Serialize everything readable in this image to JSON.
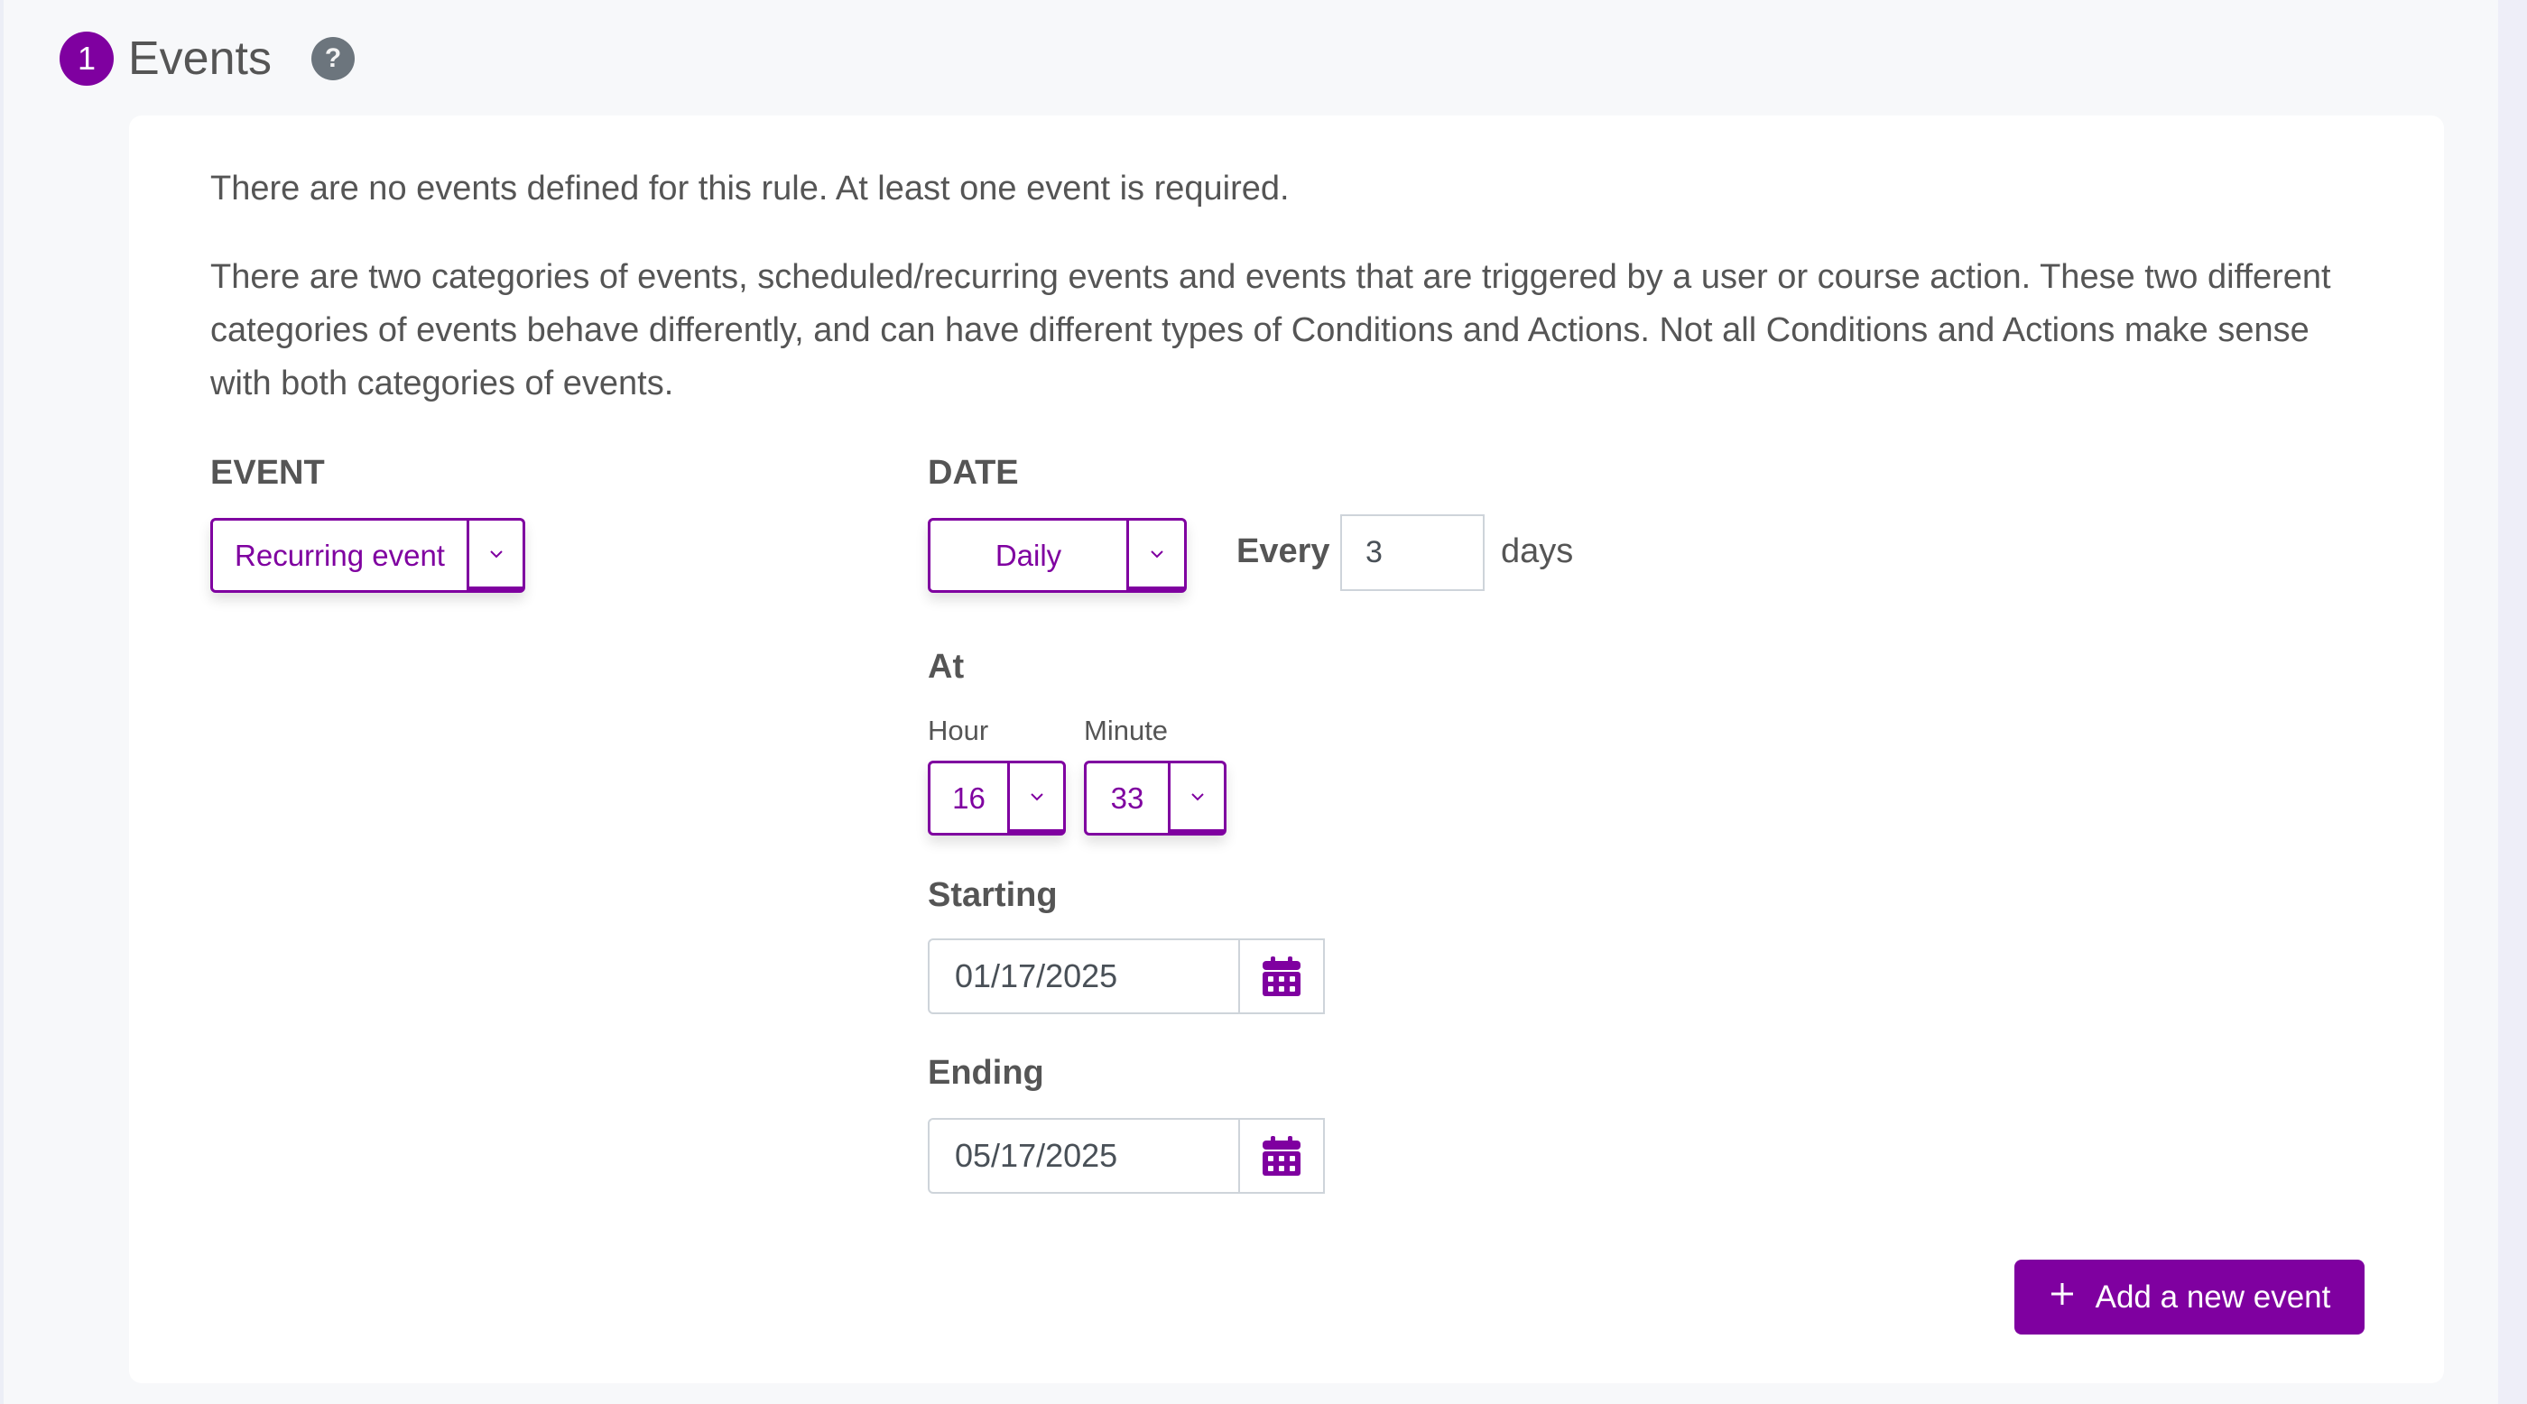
{
  "header": {
    "step_number": "1",
    "title": "Events",
    "help_icon": "question-circle-icon"
  },
  "intro": {
    "no_events_message": "There are no events defined for this rule. At least one event is required.",
    "description": "There are two categories of events, scheduled/recurring events and events that are triggered by a user or course action. These two different categories of events behave differently, and can have different types of Conditions and Actions. Not all Conditions and Actions make sense with both categories of events."
  },
  "event": {
    "label": "EVENT",
    "selected": "Recurring event"
  },
  "date": {
    "label": "DATE",
    "frequency_selected": "Daily",
    "every_label": "Every",
    "every_value": "3",
    "unit_label": "days"
  },
  "at": {
    "label": "At",
    "hour_label": "Hour",
    "hour_value": "16",
    "minute_label": "Minute",
    "minute_value": "33"
  },
  "starting": {
    "label": "Starting",
    "value": "01/17/2025",
    "icon": "calendar-icon"
  },
  "ending": {
    "label": "Ending",
    "value": "05/17/2025",
    "icon": "calendar-icon"
  },
  "actions": {
    "add_event_label": "Add a new event",
    "add_icon": "plus-icon"
  },
  "colors": {
    "accent": "#7f00a0",
    "help_icon_bg": "#6c757d",
    "text": "#555555",
    "input_border": "#ced4da",
    "page_bg": "#f7f8fa",
    "card_bg": "#ffffff"
  }
}
